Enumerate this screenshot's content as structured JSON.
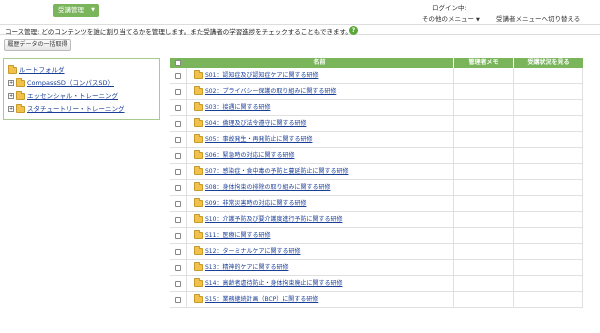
{
  "topbar": {
    "menu_label": "受講管理",
    "login_label": "ログイン中:",
    "other_menu_label": "その他のメニュー",
    "switch_label": "受講者メニューへ切り替える"
  },
  "description": "コース管理: どのコンテンツを誰に割り当てるかを管理します。また受講者の学習進捗をチェックすることもできます。",
  "help_icon": "?",
  "export_button": "履歴データの一括取得",
  "tree": {
    "items": [
      {
        "label": "ルートフォルダ",
        "expander": ""
      },
      {
        "label": "CompassSD（コンパスSD）",
        "expander": "+"
      },
      {
        "label": "エッセンシャル・トレーニング",
        "expander": "+"
      },
      {
        "label": "スタチュートリー・トレーニング",
        "expander": "+"
      }
    ]
  },
  "table": {
    "columns": [
      "名前",
      "管理者メモ",
      "受講状況を見る"
    ],
    "rows": [
      {
        "name": "S01：認知症及び認知症ケアに関する研修"
      },
      {
        "name": "S02：プライバシー保護の取り組みに関する研修"
      },
      {
        "name": "S03：接遇に関する研修"
      },
      {
        "name": "S04：倫理及び法令遵守に関する研修"
      },
      {
        "name": "S05：事故発生・再発防止に関する研修"
      },
      {
        "name": "S06：緊急時の対応に関する研修"
      },
      {
        "name": "S07：感染症・食中毒の予防と蔓延防止に関する研修"
      },
      {
        "name": "S08：身体拘束の排除の取り組みに関する研修"
      },
      {
        "name": "S09：非常災害時の対応に関する研修"
      },
      {
        "name": "S10：介護予防及び要介護度進行予防に関する研修"
      },
      {
        "name": "S11：医療に関する研修"
      },
      {
        "name": "S12：ターミナルケアに関する研修"
      },
      {
        "name": "S13：精神的ケアに関する研修"
      },
      {
        "name": "S14：高齢者虐待防止・身体拘束廃止に関する研修"
      },
      {
        "name": "S15：業務継続計画（BCP）に関する研修"
      }
    ]
  },
  "colors": {
    "accent": "#7ab55c",
    "link": "#1a3f99",
    "folder": "#f0c24b"
  }
}
